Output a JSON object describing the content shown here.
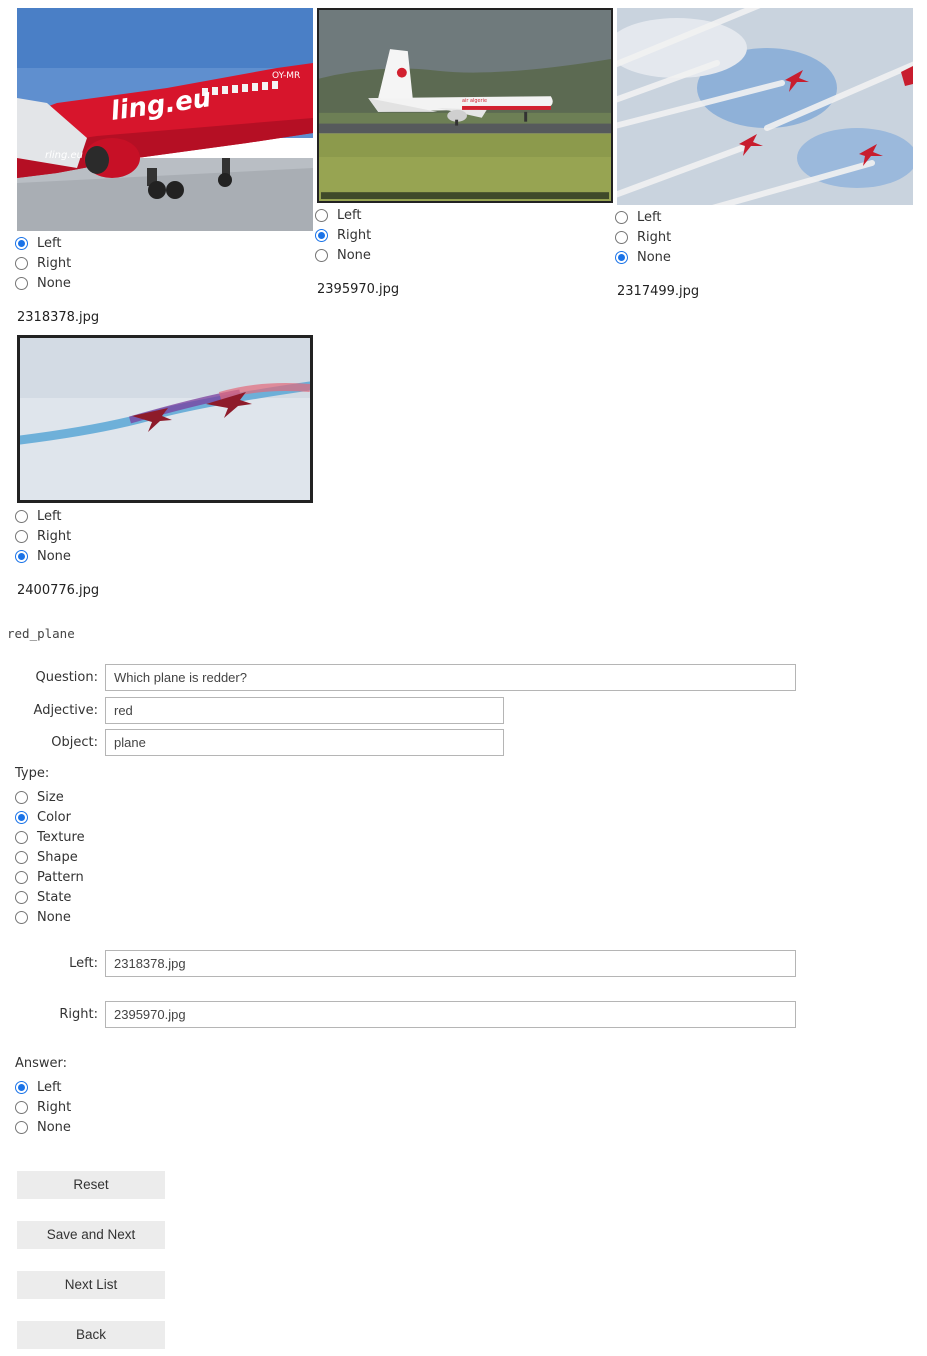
{
  "images": [
    {
      "filename": "2318378.jpg",
      "selected": "Left",
      "options": [
        "Left",
        "Right",
        "None"
      ]
    },
    {
      "filename": "2395970.jpg",
      "selected": "Right",
      "options": [
        "Left",
        "Right",
        "None"
      ]
    },
    {
      "filename": "2317499.jpg",
      "selected": "None",
      "options": [
        "Left",
        "Right",
        "None"
      ]
    },
    {
      "filename": "2400776.jpg",
      "selected": "None",
      "options": [
        "Left",
        "Right",
        "None"
      ]
    }
  ],
  "list_name": "red_plane",
  "form": {
    "question_label": "Question:",
    "question_value": "Which plane is redder?",
    "adjective_label": "Adjective:",
    "adjective_value": "red",
    "object_label": "Object:",
    "object_value": "plane",
    "type_label": "Type:",
    "type_options": [
      "Size",
      "Color",
      "Texture",
      "Shape",
      "Pattern",
      "State",
      "None"
    ],
    "type_selected": "Color",
    "left_label": "Left:",
    "left_value": "2318378.jpg",
    "right_label": "Right:",
    "right_value": "2395970.jpg",
    "answer_label": "Answer:",
    "answer_options": [
      "Left",
      "Right",
      "None"
    ],
    "answer_selected": "Left"
  },
  "buttons": {
    "reset": "Reset",
    "save_next": "Save and Next",
    "next_list": "Next List",
    "back": "Back"
  },
  "colors": {
    "accent": "#1a73e8",
    "button_bg": "#ececec",
    "input_border": "#b5b5b5"
  }
}
